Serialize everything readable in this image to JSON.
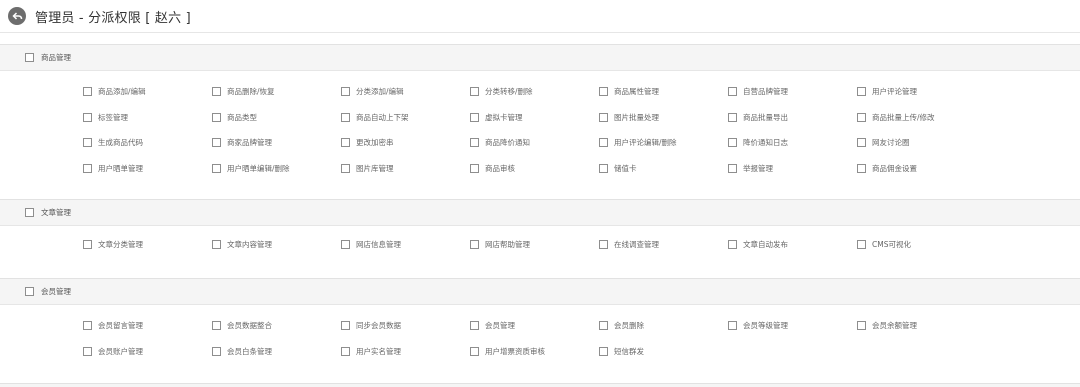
{
  "header": {
    "title": "管理员 - 分派权限 [ 赵六 ]"
  },
  "sections": [
    {
      "label": "商品管理",
      "rows": [
        [
          "商品添加/编辑",
          "商品删除/恢复",
          "分类添加/编辑",
          "分类转移/删除",
          "商品属性管理",
          "自营品牌管理",
          "用户评论管理"
        ],
        [
          "标签管理",
          "商品类型",
          "商品自动上下架",
          "虚拟卡管理",
          "图片批量处理",
          "商品批量导出",
          "商品批量上传/修改"
        ],
        [
          "生成商品代码",
          "商家品牌管理",
          "更改加密串",
          "商品降价通知",
          "用户评论编辑/删除",
          "降价通知日志",
          "网友讨论圈"
        ],
        [
          "用户晒单管理",
          "用户晒单编辑/删除",
          "图片库管理",
          "商品审核",
          "储值卡",
          "举报管理",
          "商品佣金设置"
        ]
      ]
    },
    {
      "label": "文章管理",
      "rows": [
        [
          "文章分类管理",
          "文章内容管理",
          "网店信息管理",
          "网店帮助管理",
          "在线调查管理",
          "文章自动发布",
          "CMS可视化"
        ]
      ]
    },
    {
      "label": "会员管理",
      "rows": [
        [
          "会员留言管理",
          "会员数据整合",
          "同步会员数据",
          "会员管理",
          "会员删除",
          "会员等级管理",
          "会员余额管理"
        ],
        [
          "会员账户管理",
          "会员白条管理",
          "用户实名管理",
          "用户增票资质审核",
          "短信群发"
        ]
      ]
    }
  ]
}
